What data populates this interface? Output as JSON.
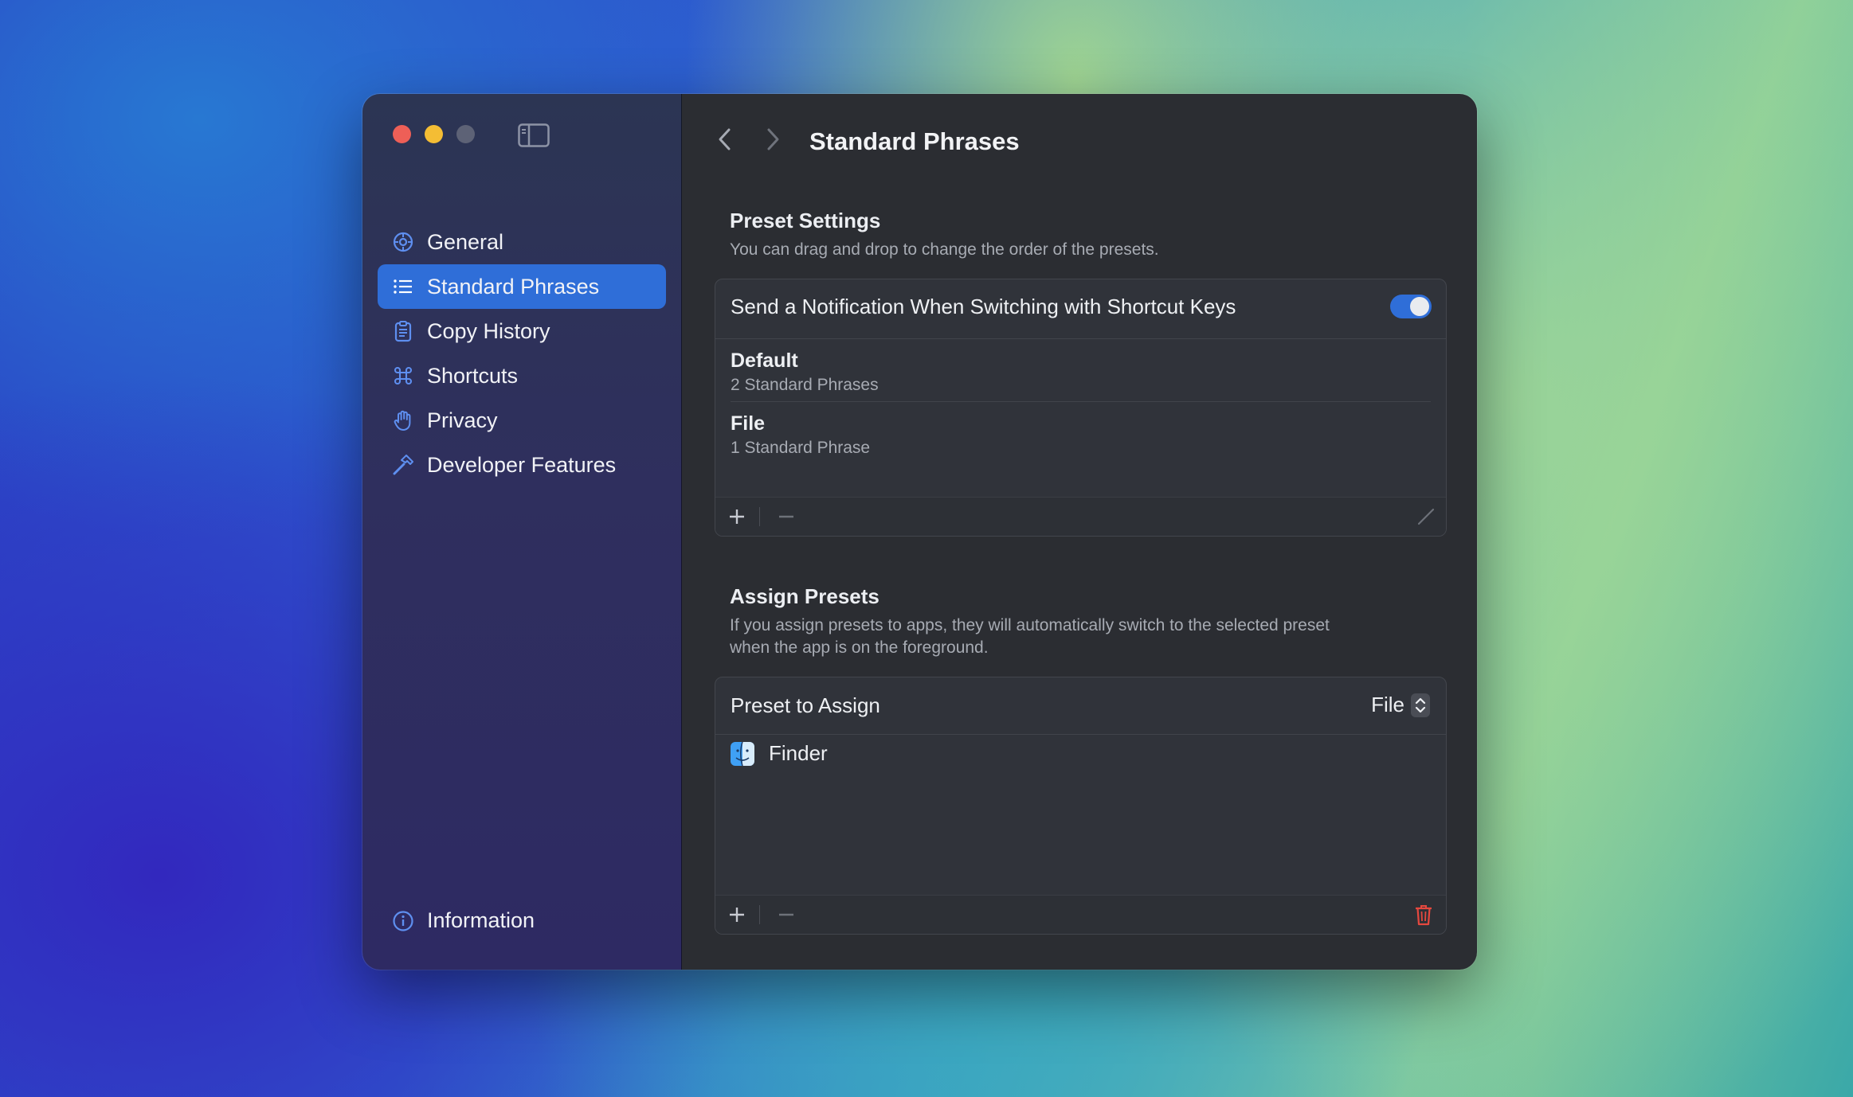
{
  "header": {
    "title": "Standard Phrases"
  },
  "sidebar": {
    "items": [
      {
        "label": "General",
        "icon": "gear-icon"
      },
      {
        "label": "Standard Phrases",
        "icon": "list-icon",
        "active": true
      },
      {
        "label": "Copy History",
        "icon": "clipboard-icon"
      },
      {
        "label": "Shortcuts",
        "icon": "command-icon"
      },
      {
        "label": "Privacy",
        "icon": "hand-icon"
      },
      {
        "label": "Developer Features",
        "icon": "hammer-icon"
      }
    ],
    "footer": {
      "label": "Information",
      "icon": "info-icon"
    }
  },
  "preset_settings": {
    "title": "Preset Settings",
    "description": "You can drag and drop to change the order of the presets.",
    "notification_label": "Send a Notification When Switching with Shortcut Keys",
    "notification_enabled": true,
    "presets": [
      {
        "name": "Default",
        "count": "2 Standard Phrases"
      },
      {
        "name": "File",
        "count": "1 Standard Phrase"
      }
    ]
  },
  "assign_presets": {
    "title": "Assign Presets",
    "description_line1": "If you assign presets to apps, they will automatically switch to the selected preset",
    "description_line2": "when the app is on the foreground.",
    "preset_label": "Preset to Assign",
    "preset_value": "File",
    "apps": [
      {
        "name": "Finder",
        "icon": "finder-icon"
      }
    ]
  },
  "colors": {
    "accent": "#2f6ed8",
    "delete": "#e5483f"
  }
}
